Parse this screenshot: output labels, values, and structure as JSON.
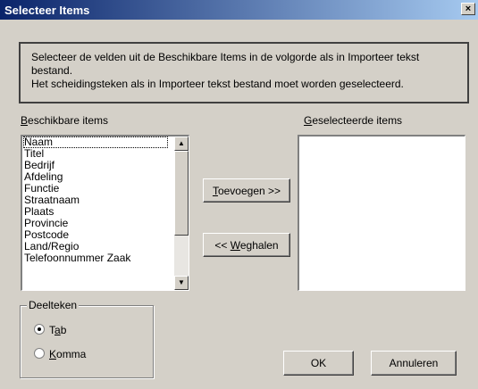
{
  "window": {
    "title": "Selecteer Items",
    "close_label": "×"
  },
  "instructions": {
    "line1": "Selecteer de velden uit de Beschikbare Items in de volgorde als in Importeer tekst",
    "line2": "bestand.",
    "line3": "Het scheidingsteken als in Importeer tekst bestand moet worden geselecteerd."
  },
  "available": {
    "label_underlined": "B",
    "label_rest": "eschikbare items",
    "items": [
      "Naam",
      "Titel",
      "Bedrijf",
      "Afdeling",
      "Functie",
      "Straatnaam",
      "Plaats",
      "Provincie",
      "Postcode",
      "Land/Regio",
      "Telefoonnummer Zaak"
    ]
  },
  "selected": {
    "label_underlined": "G",
    "label_rest": "eselecteerde items",
    "items": []
  },
  "buttons": {
    "add_underlined": "T",
    "add_rest": "oevoegen >>",
    "remove_prefix": "<< ",
    "remove_underlined": "W",
    "remove_rest": "eghalen",
    "ok": "OK",
    "cancel": "Annuleren"
  },
  "delimiter": {
    "legend": "Deelteken",
    "options": [
      {
        "pre": "T",
        "underlined": "a",
        "post": "b",
        "checked": true
      },
      {
        "pre": "",
        "underlined": "K",
        "post": "omma",
        "checked": false
      }
    ]
  },
  "icons": {
    "scroll_up": "▲",
    "scroll_down": "▼"
  }
}
